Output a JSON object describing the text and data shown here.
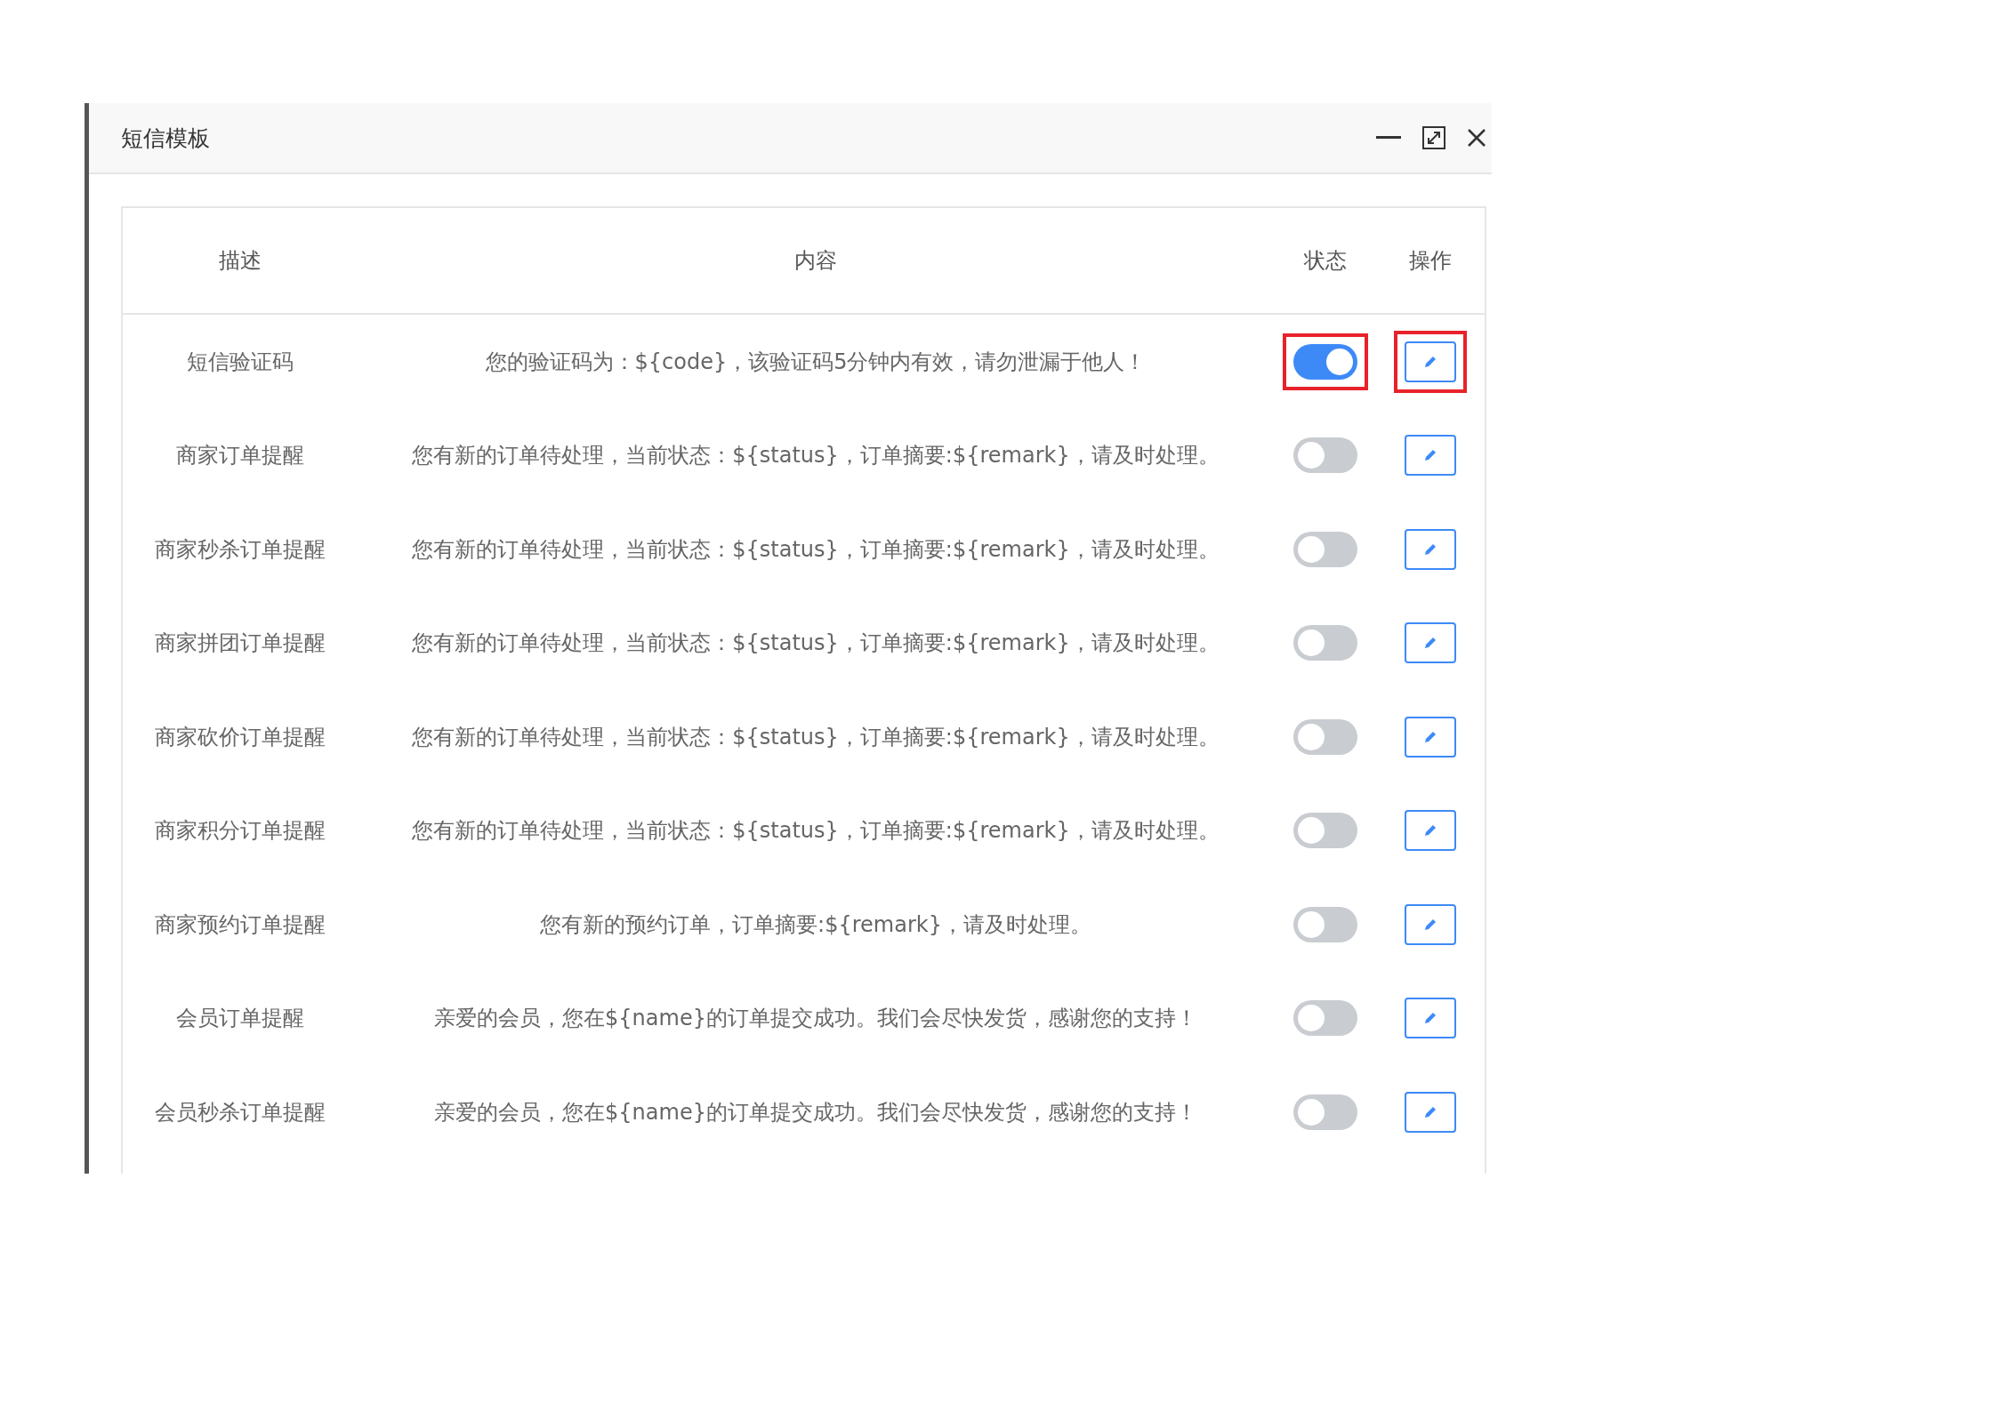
{
  "dialog": {
    "title": "短信模板"
  },
  "table": {
    "columns": [
      "描述",
      "内容",
      "状态",
      "操作"
    ],
    "rows": [
      {
        "description": "短信验证码",
        "content": "您的验证码为：${code}，该验证码5分钟内有效，请勿泄漏于他人！",
        "on": true,
        "highlighted": true
      },
      {
        "description": "商家订单提醒",
        "content": "您有新的订单待处理，当前状态：${status}，订单摘要:${remark}，请及时处理。",
        "on": false,
        "highlighted": false
      },
      {
        "description": "商家秒杀订单提醒",
        "content": "您有新的订单待处理，当前状态：${status}，订单摘要:${remark}，请及时处理。",
        "on": false,
        "highlighted": false
      },
      {
        "description": "商家拼团订单提醒",
        "content": "您有新的订单待处理，当前状态：${status}，订单摘要:${remark}，请及时处理。",
        "on": false,
        "highlighted": false
      },
      {
        "description": "商家砍价订单提醒",
        "content": "您有新的订单待处理，当前状态：${status}，订单摘要:${remark}，请及时处理。",
        "on": false,
        "highlighted": false
      },
      {
        "description": "商家积分订单提醒",
        "content": "您有新的订单待处理，当前状态：${status}，订单摘要:${remark}，请及时处理。",
        "on": false,
        "highlighted": false
      },
      {
        "description": "商家预约订单提醒",
        "content": "您有新的预约订单，订单摘要:${remark}，请及时处理。",
        "on": false,
        "highlighted": false
      },
      {
        "description": "会员订单提醒",
        "content": "亲爱的会员，您在${name}的订单提交成功。我们会尽快发货，感谢您的支持！",
        "on": false,
        "highlighted": false
      },
      {
        "description": "会员秒杀订单提醒",
        "content": "亲爱的会员，您在${name}的订单提交成功。我们会尽快发货，感谢您的支持！",
        "on": false,
        "highlighted": false
      }
    ]
  }
}
